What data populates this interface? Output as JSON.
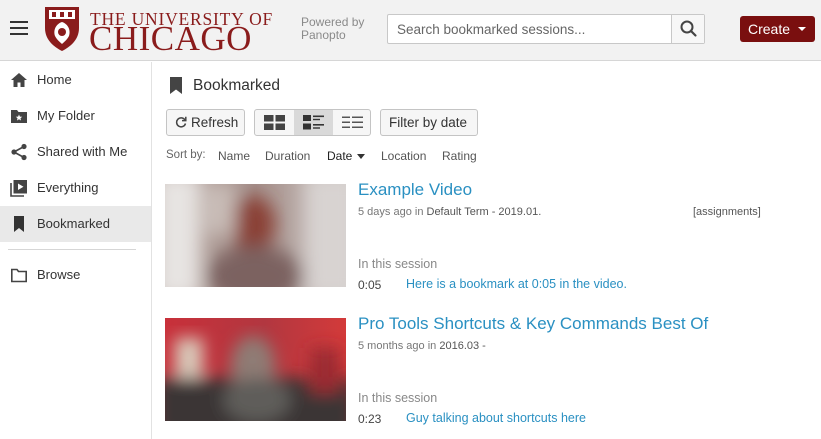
{
  "header": {
    "logo_line1": "THE UNIVERSITY OF",
    "logo_line2": "CHICAGO",
    "powered_line1": "Powered by",
    "powered_line2": "Panopto",
    "search_placeholder": "Search bookmarked sessions...",
    "create_label": "Create",
    "brand_color": "#7a0f0f"
  },
  "sidebar": {
    "items": [
      {
        "label": "Home",
        "icon": "home-icon"
      },
      {
        "label": "My Folder",
        "icon": "folder-star-icon"
      },
      {
        "label": "Shared with Me",
        "icon": "share-icon"
      },
      {
        "label": "Everything",
        "icon": "play-stack-icon"
      },
      {
        "label": "Bookmarked",
        "icon": "bookmark-icon",
        "active": true
      },
      {
        "label": "Browse",
        "icon": "folder-icon"
      }
    ]
  },
  "main": {
    "title": "Bookmarked",
    "toolbar": {
      "refresh_label": "Refresh",
      "filter_label": "Filter by date",
      "view_modes": [
        "thumbnail-grid",
        "detailed-list",
        "compact-list"
      ],
      "selected_view": "detailed-list"
    },
    "sort": {
      "label": "Sort by:",
      "options": [
        "Name",
        "Duration",
        "Date",
        "Location",
        "Rating"
      ],
      "active": "Date",
      "direction": "descending"
    },
    "sessions": [
      {
        "title": "Example Video",
        "age": "5 days ago in",
        "term": "Default Term - 2019.01.",
        "tag": "[assignments]",
        "in_session_label": "In this session",
        "bookmark_time": "0:05",
        "bookmark_text": "Here is a bookmark at 0:05 in the video."
      },
      {
        "title": "Pro Tools Shortcuts & Key Commands Best Of",
        "age": "5 months ago in",
        "term": "2016.03 -",
        "tag": "",
        "in_session_label": "In this session",
        "bookmark_time": "0:23",
        "bookmark_text": "Guy talking about shortcuts here"
      }
    ]
  }
}
